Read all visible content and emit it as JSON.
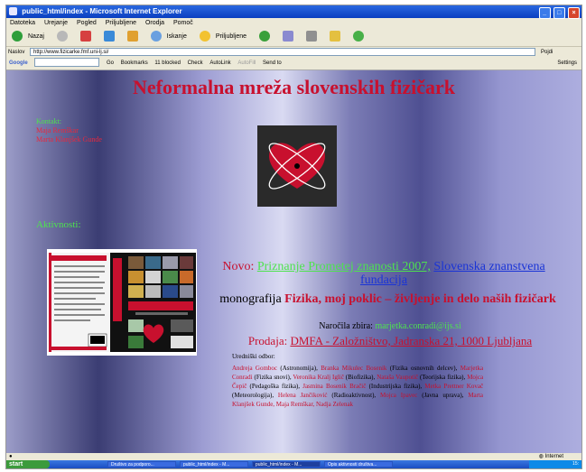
{
  "window": {
    "title": "public_html/index - Microsoft Internet Explorer"
  },
  "menu": [
    "Datoteka",
    "Urejanje",
    "Pogled",
    "Priljubljene",
    "Orodja",
    "Pomoč"
  ],
  "toolbar": {
    "back": "Nazaj",
    "search": "Iskanje",
    "favorites": "Priljubljene"
  },
  "address": {
    "label": "Naslov",
    "url": "http://www.fizicarke.fmf.uni-lj.si/",
    "go": "Pojdi"
  },
  "google_bar": {
    "logo": "Google",
    "go": "Go",
    "bookmarks": "Bookmarks",
    "blocked": "11 blocked",
    "check": "Check",
    "autolink": "AutoLink",
    "autofill": "AutoFill",
    "sendto": "Send to",
    "settings": "Settings"
  },
  "page": {
    "title": "Neformalna mreža slovenskih fizičark",
    "contacts_label": "Kontakt:",
    "contacts": [
      "Maja Remškar",
      "Marta Klanjšek Gunde"
    ],
    "activities_label": "Aktivnosti:",
    "novo_label": "Novo:",
    "novo_award": "Priznanje Prometej znanosti 2007,",
    "novo_link": "Slovenska znanstvena fundacija",
    "mono_prefix": "monografija",
    "mono_title": "Fizika, moj poklic – življenje in delo naših fizičark",
    "orders_label": "Naročila zbira:",
    "orders_email": "marjetka.conradi@ijs.si",
    "sale_label": "Prodaja:",
    "sale_place": "DMFA - Založništvo, Jadranska 21, 1000 Ljubljana",
    "editors_label": "Uredniški odbor:",
    "editors": [
      {
        "name": "Andreja Gomboc",
        "field": "(Astronomija),"
      },
      {
        "name": "Branka Mikulec Bosenik",
        "field": "(Fizika osnovnih delcev),"
      },
      {
        "name": "Marjetka Conradi",
        "field": "(Fizika snovi),"
      },
      {
        "name": "Veronika Kralj Iglič",
        "field": "(Biofizika),"
      },
      {
        "name": "Nataša Vaupotič",
        "field": "(Teorijska fizika),"
      },
      {
        "name": "Mojca Čepič",
        "field": "(Pedagoška fizika),"
      },
      {
        "name": "Jasmina Bosenik Bračič",
        "field": "(Industrijska fizika),"
      },
      {
        "name": "Metka Prettner Kovač",
        "field": "(Meteorologija),"
      },
      {
        "name": "Helena Jančiković",
        "field": "(Radioaktivnost),"
      },
      {
        "name": "Mojca Ipavec",
        "field": "(Javna uprava),"
      },
      {
        "name": "Marta Klanjšek Gunde,",
        "field": ""
      },
      {
        "name": "Maja Remškar,",
        "field": ""
      },
      {
        "name": "Nadja Zelenak",
        "field": ""
      }
    ]
  },
  "status": {
    "zone": "Internet"
  },
  "taskbar": {
    "start": "start",
    "tasks": [
      "Društvo za podporo...",
      "public_html/index - M...",
      "public_html/index - M...",
      "Opis aktivnosti društva..."
    ],
    "clock": "15:"
  },
  "colors": {
    "title_red": "#c8102e",
    "accent_green": "#4ee34e",
    "link_blue": "#1a34d6"
  }
}
